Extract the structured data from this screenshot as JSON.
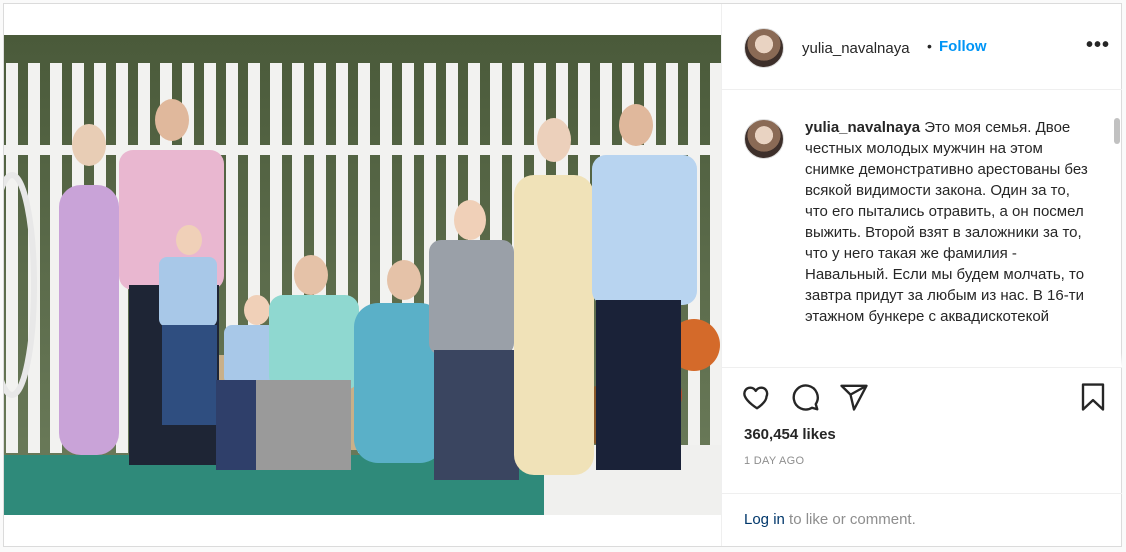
{
  "post": {
    "username": "yulia_navalnaya",
    "follow_label": "Follow",
    "separator": "•",
    "more_label": "•••",
    "caption_username": "yulia_navalnaya",
    "caption_text": "Это моя семья. Двое честных молодых мужчин на этом снимке демонстративно арестованы без всякой видимости закона. Один за то, что его пытались отравить, а он посмел выжить. Второй взят в заложники за то, что у него такая же фамилия - Навальный. Если мы будем молчать, то завтра придут за любым из нас. В 16-ти этажном бункере с аквадискотекой",
    "likes": "360,454 likes",
    "timestamp": "1 DAY AGO",
    "login_link": "Log in",
    "login_rest": " to like or comment."
  },
  "icons": {
    "like": "heart-icon",
    "comment": "comment-bubble-icon",
    "share": "paper-plane-icon",
    "save": "bookmark-icon"
  },
  "colors": {
    "link_blue": "#0095f6",
    "muted": "#8e8e8e",
    "text": "#262626"
  }
}
